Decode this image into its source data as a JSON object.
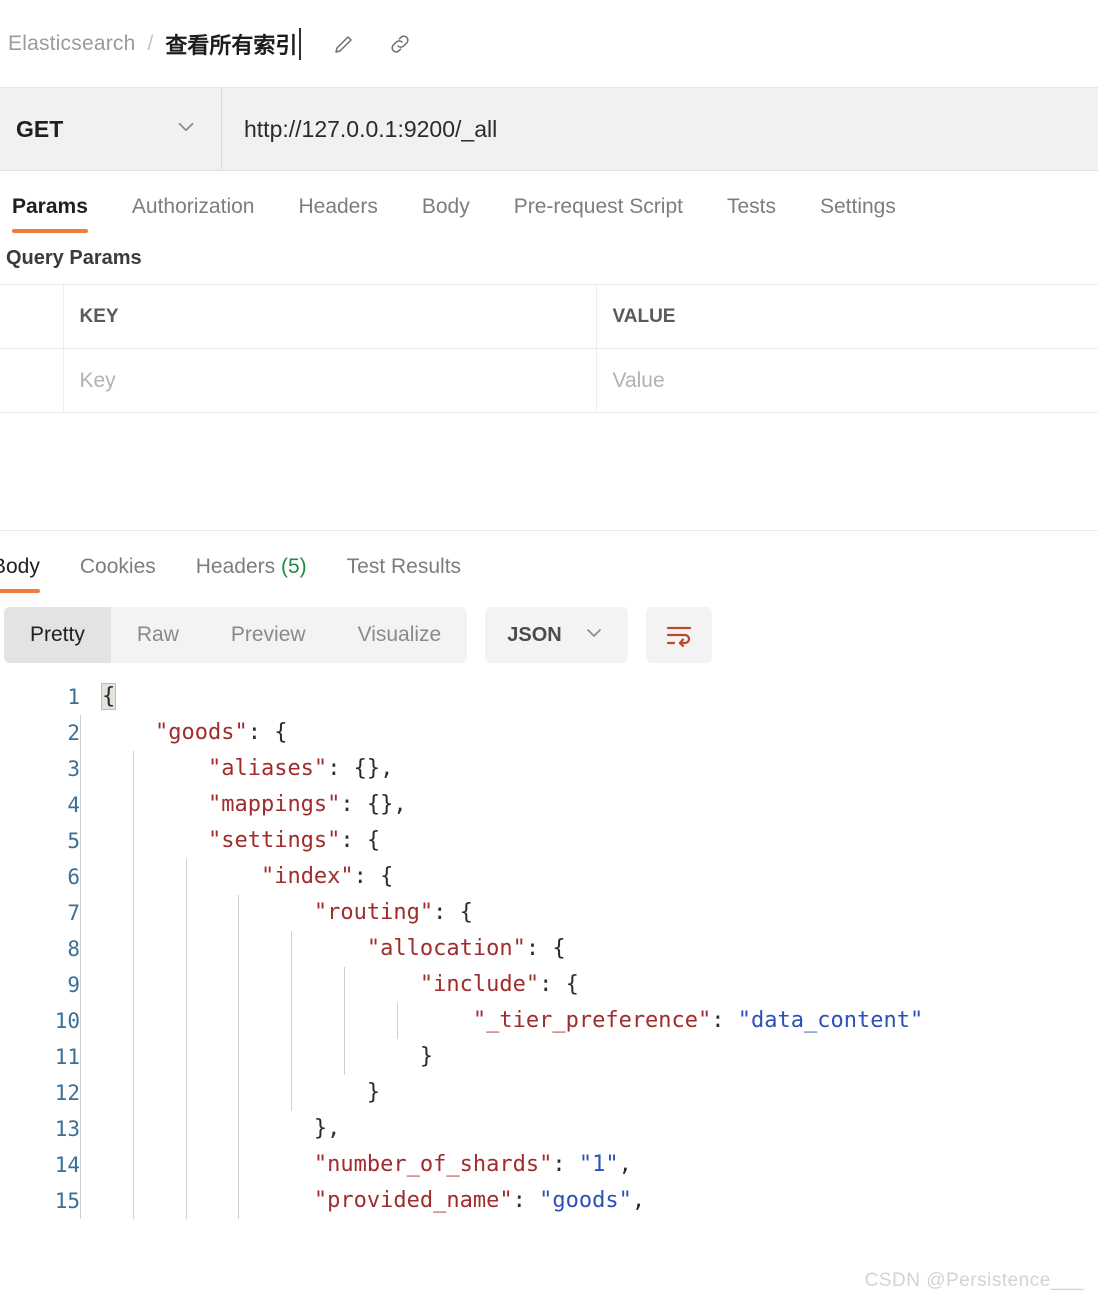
{
  "breadcrumb": {
    "root": "Elasticsearch",
    "separator": "/",
    "current": "查看所有索引",
    "edit_icon": "pencil-icon",
    "link_icon": "link-icon"
  },
  "request": {
    "method": "GET",
    "url": "http://127.0.0.1:9200/_all",
    "tabs": [
      {
        "label": "Params",
        "active": true
      },
      {
        "label": "Authorization",
        "active": false
      },
      {
        "label": "Headers",
        "active": false
      },
      {
        "label": "Body",
        "active": false
      },
      {
        "label": "Pre-request Script",
        "active": false
      },
      {
        "label": "Tests",
        "active": false
      },
      {
        "label": "Settings",
        "active": false
      }
    ],
    "query_params": {
      "title": "Query Params",
      "columns": [
        "KEY",
        "VALUE"
      ],
      "rows": [
        {
          "key_placeholder": "Key",
          "value_placeholder": "Value"
        }
      ]
    }
  },
  "response": {
    "tabs": [
      {
        "label": "Body",
        "active": true
      },
      {
        "label": "Cookies",
        "active": false
      },
      {
        "label": "Headers",
        "count": "(5)",
        "active": false
      },
      {
        "label": "Test Results",
        "active": false
      }
    ],
    "format_modes": [
      {
        "label": "Pretty",
        "active": true
      },
      {
        "label": "Raw",
        "active": false
      },
      {
        "label": "Preview",
        "active": false
      },
      {
        "label": "Visualize",
        "active": false
      }
    ],
    "language": "JSON",
    "wrap_icon": "word-wrap-icon",
    "line_numbers": [
      "1",
      "2",
      "3",
      "4",
      "5",
      "6",
      "7",
      "8",
      "9",
      "10",
      "11",
      "12",
      "13",
      "14",
      "15"
    ],
    "body_lines": [
      {
        "indent": 0,
        "tokens": [
          {
            "t": "{",
            "c": "p",
            "hl": true
          }
        ]
      },
      {
        "indent": 1,
        "tokens": [
          {
            "t": "\"goods\"",
            "c": "k"
          },
          {
            "t": ": {",
            "c": "p"
          }
        ]
      },
      {
        "indent": 2,
        "tokens": [
          {
            "t": "\"aliases\"",
            "c": "k"
          },
          {
            "t": ": {},",
            "c": "p"
          }
        ]
      },
      {
        "indent": 2,
        "tokens": [
          {
            "t": "\"mappings\"",
            "c": "k"
          },
          {
            "t": ": {},",
            "c": "p"
          }
        ]
      },
      {
        "indent": 2,
        "tokens": [
          {
            "t": "\"settings\"",
            "c": "k"
          },
          {
            "t": ": {",
            "c": "p"
          }
        ]
      },
      {
        "indent": 3,
        "tokens": [
          {
            "t": "\"index\"",
            "c": "k"
          },
          {
            "t": ": {",
            "c": "p"
          }
        ]
      },
      {
        "indent": 4,
        "tokens": [
          {
            "t": "\"routing\"",
            "c": "k"
          },
          {
            "t": ": {",
            "c": "p"
          }
        ]
      },
      {
        "indent": 5,
        "tokens": [
          {
            "t": "\"allocation\"",
            "c": "k"
          },
          {
            "t": ": {",
            "c": "p"
          }
        ]
      },
      {
        "indent": 6,
        "tokens": [
          {
            "t": "\"include\"",
            "c": "k"
          },
          {
            "t": ": {",
            "c": "p"
          }
        ]
      },
      {
        "indent": 7,
        "tokens": [
          {
            "t": "\"_tier_preference\"",
            "c": "k"
          },
          {
            "t": ": ",
            "c": "p"
          },
          {
            "t": "\"data_content\"",
            "c": "s"
          }
        ]
      },
      {
        "indent": 6,
        "tokens": [
          {
            "t": "}",
            "c": "p"
          }
        ]
      },
      {
        "indent": 5,
        "tokens": [
          {
            "t": "}",
            "c": "p"
          }
        ]
      },
      {
        "indent": 4,
        "tokens": [
          {
            "t": "},",
            "c": "p"
          }
        ]
      },
      {
        "indent": 4,
        "tokens": [
          {
            "t": "\"number_of_shards\"",
            "c": "k"
          },
          {
            "t": ": ",
            "c": "p"
          },
          {
            "t": "\"1\"",
            "c": "s"
          },
          {
            "t": ",",
            "c": "p"
          }
        ]
      },
      {
        "indent": 4,
        "tokens": [
          {
            "t": "\"provided_name\"",
            "c": "k"
          },
          {
            "t": ": ",
            "c": "p"
          },
          {
            "t": "\"goods\"",
            "c": "s"
          },
          {
            "t": ",",
            "c": "p"
          }
        ]
      }
    ]
  },
  "watermark": "CSDN @Persistence___",
  "colors": {
    "accent": "#ef7c3c",
    "json_key": "#a02c2c",
    "json_string": "#2b50b8",
    "line_number": "#3b6f96",
    "header_count": "#1f8a42"
  }
}
